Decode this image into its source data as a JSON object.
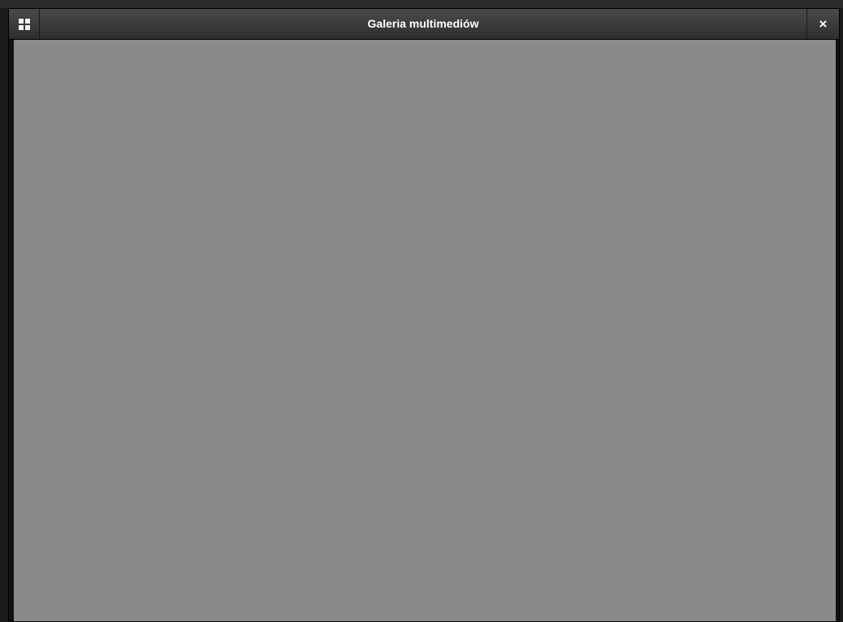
{
  "modal": {
    "title": "Galeria multimediów",
    "grid_icon": "grid-icon",
    "close_label": "×"
  },
  "media": {
    "placeholder_note": ""
  },
  "colors": {
    "header": "#3a3a3a",
    "title_text": "#ffffff",
    "page_bg": "#1b1b1b"
  }
}
